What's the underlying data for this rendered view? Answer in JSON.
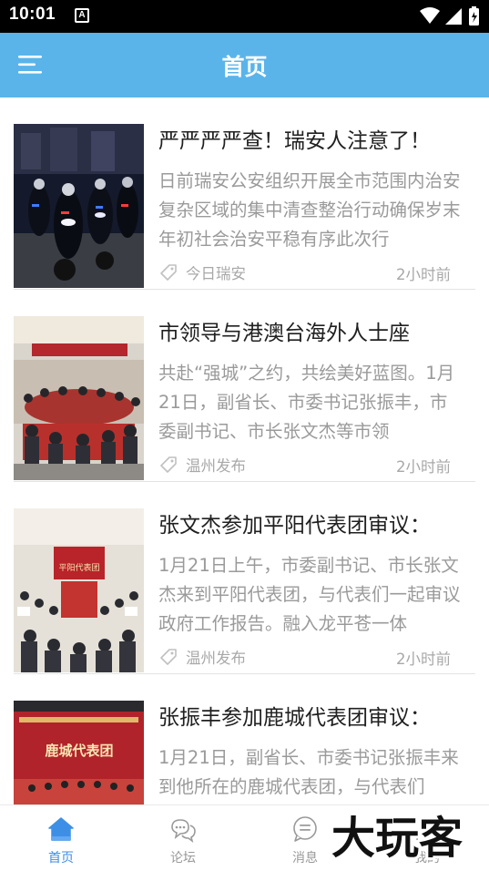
{
  "status_bar": {
    "time": "10:01",
    "notification_badge": "A"
  },
  "header": {
    "title": "首页"
  },
  "colors": {
    "header_bg": "#5ab4ea",
    "active_tab": "#3d8fe6",
    "inactive_tab": "#999999"
  },
  "news": [
    {
      "title": "严严严严查！瑞安人注意了！",
      "summary": "日前瑞安公安组织开展全市范围内治安复杂区域的集中清查整治行动确保岁末年初社会治安平稳有序此次行",
      "source": "今日瑞安",
      "time": "2小时前"
    },
    {
      "title": "市领导与港澳台海外人士座",
      "summary": "共赴“强城”之约，共绘美好蓝图。1月21日，副省长、市委书记张振丰，市委副书记、市长张文杰等市领",
      "source": "温州发布",
      "time": "2小时前"
    },
    {
      "title": "张文杰参加平阳代表团审议：",
      "summary": "1月21日上午，市委副书记、市长张文杰来到平阳代表团，与代表们一起审议政府工作报告。融入龙平苍一体",
      "source": "温州发布",
      "time": "2小时前"
    },
    {
      "title": "张振丰参加鹿城代表团审议：",
      "summary": "1月21日，副省长、市委书记张振丰来到他所在的鹿城代表团，与代表们",
      "source": "",
      "time": "",
      "thumb_banner": "鹿城代表团"
    }
  ],
  "thumb3_banner": "平阳代表团",
  "tabs": [
    {
      "label": "首页",
      "icon": "home-icon",
      "active": true
    },
    {
      "label": "论坛",
      "icon": "chat-bubbles-icon",
      "active": false
    },
    {
      "label": "消息",
      "icon": "message-icon",
      "active": false
    },
    {
      "label": "我的",
      "icon": "profile-icon",
      "active": false
    }
  ],
  "watermark": "大玩客"
}
